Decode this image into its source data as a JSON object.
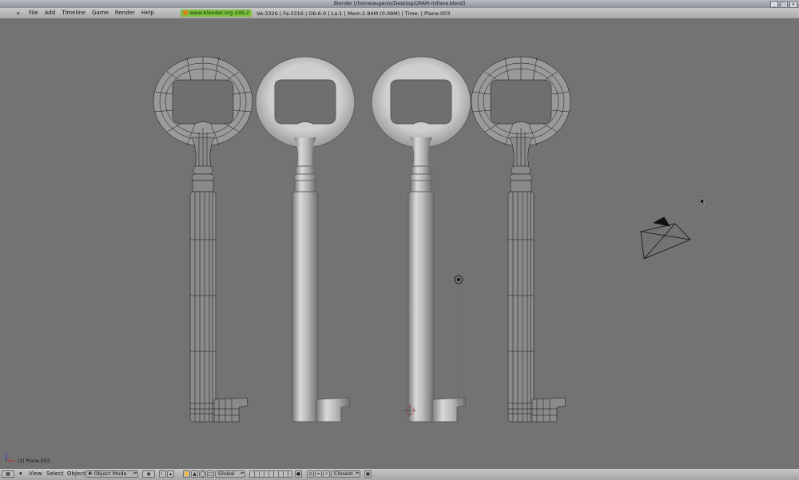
{
  "window": {
    "title": "Blender [/home/eugenio/Desktop/ORAM-millave.blend]",
    "buttons": [
      "_",
      "□",
      "×"
    ]
  },
  "menubar": {
    "items": [
      "File",
      "Add",
      "Timeline",
      "Game",
      "Render",
      "Help"
    ],
    "url": "www.blender.org 249.2",
    "stats": "Ve:3326 | Fa:3316 | Ob:6-0 | La:1  | Mem:2.94M (0.09M)  | Time: | Plane.003"
  },
  "viewport": {
    "object_info": "(1) Plane.003",
    "background": "#737373",
    "objects": [
      "key-wireframe-left",
      "key-solid-center-left",
      "key-solid-center-right",
      "key-wireframe-right",
      "camera",
      "lamp",
      "3d-cursor"
    ]
  },
  "bottombar": {
    "menus": [
      "View",
      "Select",
      "Object"
    ],
    "mode": "Object Mode",
    "orientation": "Global",
    "snap": "Closest"
  }
}
